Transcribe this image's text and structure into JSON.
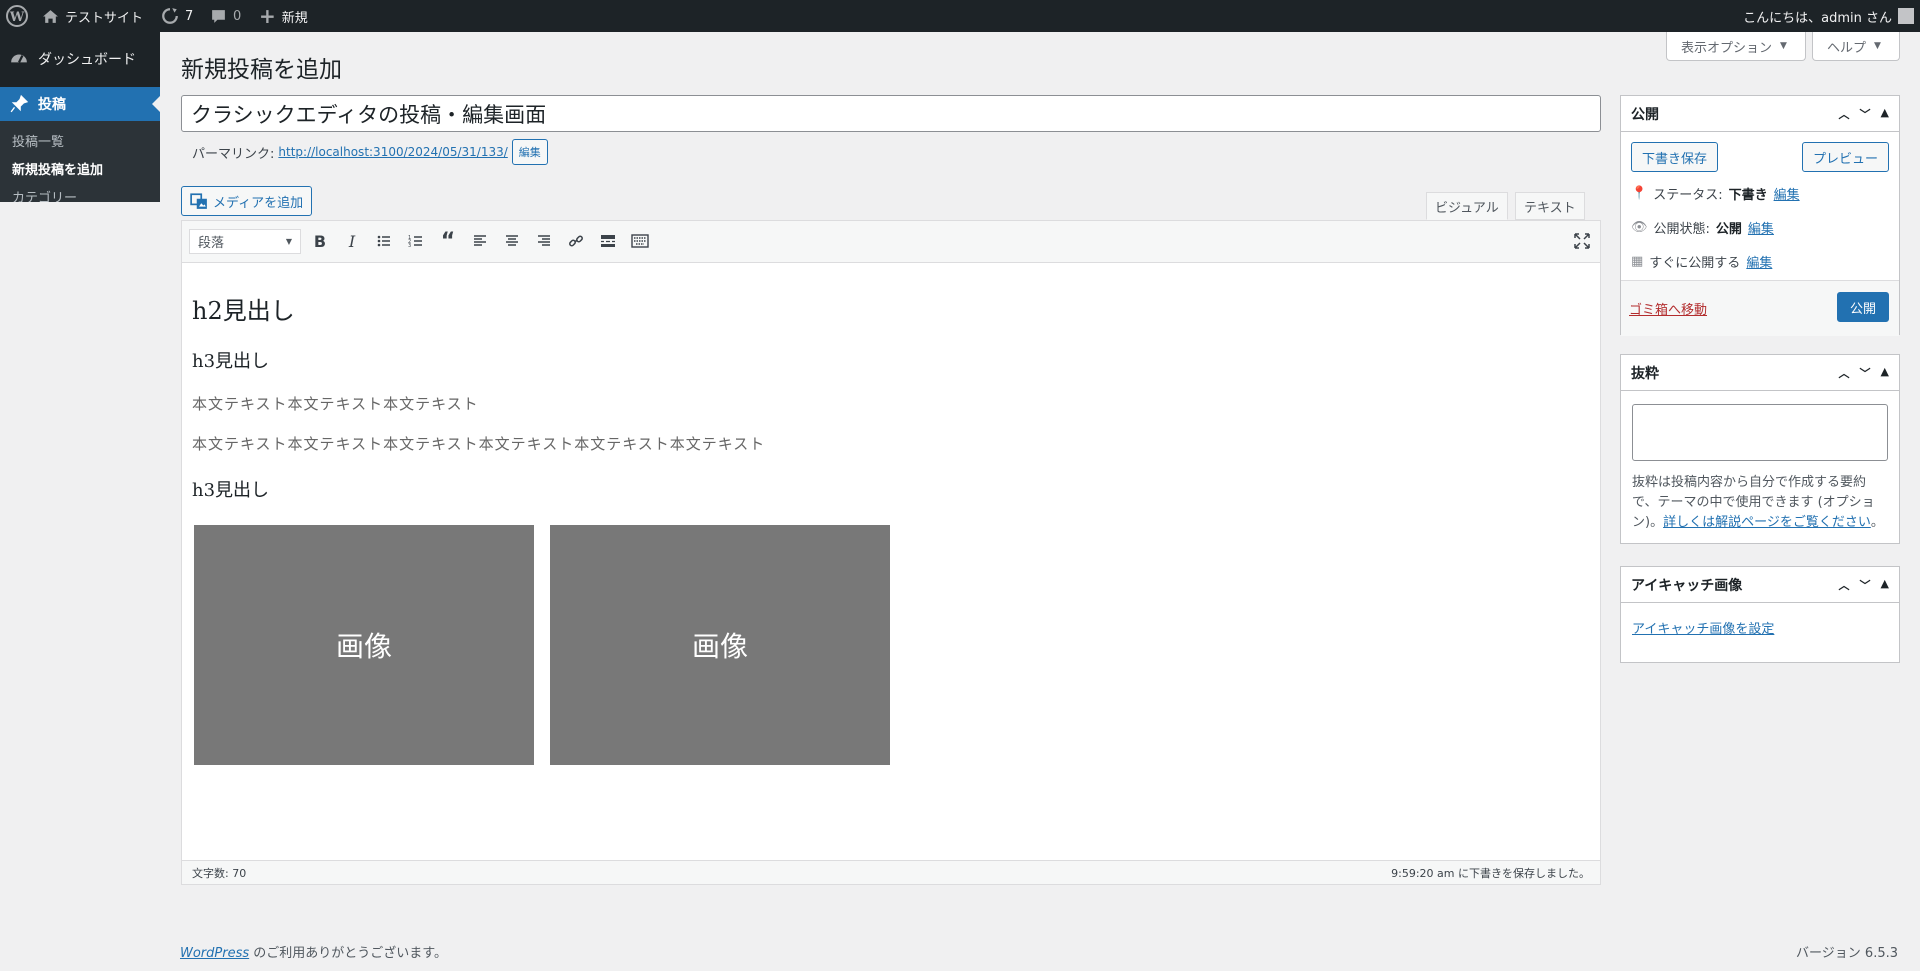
{
  "adminbar": {
    "site_name": "テストサイト",
    "updates_count": "7",
    "comments_count": "0",
    "new_label": "新規",
    "greeting": "こんにちは、admin さん"
  },
  "sidebar_menu": {
    "dashboard": "ダッシュボード",
    "posts": "投稿",
    "sub_items": [
      "投稿一覧",
      "新規投稿を追加",
      "カテゴリー"
    ]
  },
  "screen_options": {
    "display_options": "表示オプション",
    "help": "ヘルプ"
  },
  "page": {
    "title": "新規投稿を追加",
    "post_title": "クラシックエディタの投稿・編集画面",
    "permalink_label": "パーマリンク:",
    "permalink_url": "http://localhost:3100/2024/05/31/133/",
    "permalink_edit": "編集",
    "add_media": "メディアを追加",
    "tab_visual": "ビジュアル",
    "tab_text": "テキスト"
  },
  "editor": {
    "format_select": "段落",
    "content": {
      "h2": "h2見出し",
      "h3_1": "h3見出し",
      "p1": "本文テキスト本文テキスト本文テキスト",
      "p2": "本文テキスト本文テキスト本文テキスト本文テキスト本文テキスト本文テキスト",
      "h3_2": "h3見出し",
      "image1": "画像",
      "image2": "画像"
    },
    "word_count": "文字数: 70",
    "autosave": "9:59:20 am に下書きを保存しました。"
  },
  "publish_box": {
    "title": "公開",
    "save_draft": "下書き保存",
    "preview": "プレビュー",
    "status_label": "ステータス:",
    "status_value": "下書き",
    "visibility_label": "公開状態:",
    "visibility_value": "公開",
    "schedule_label": "すぐに公開する",
    "edit_link": "編集",
    "trash": "ゴミ箱へ移動",
    "publish": "公開"
  },
  "excerpt_box": {
    "title": "抜粋",
    "help_text_before": "抜粋は投稿内容から自分で作成する要約で、テーマの中で使用できます (オプション)。",
    "help_link": "詳しくは解説ページをご覧ください",
    "help_text_after": "。"
  },
  "featured_box": {
    "title": "アイキャッチ画像",
    "set_link": "アイキャッチ画像を設定"
  },
  "footer": {
    "wordpress_link": "WordPress",
    "thanks": " のご利用ありがとうございます。",
    "version": "バージョン 6.5.3"
  },
  "colors": {
    "accent": "#2271b1",
    "adminbar": "#1d2327",
    "background": "#f0f0f1",
    "image_placeholder": "#787878"
  }
}
